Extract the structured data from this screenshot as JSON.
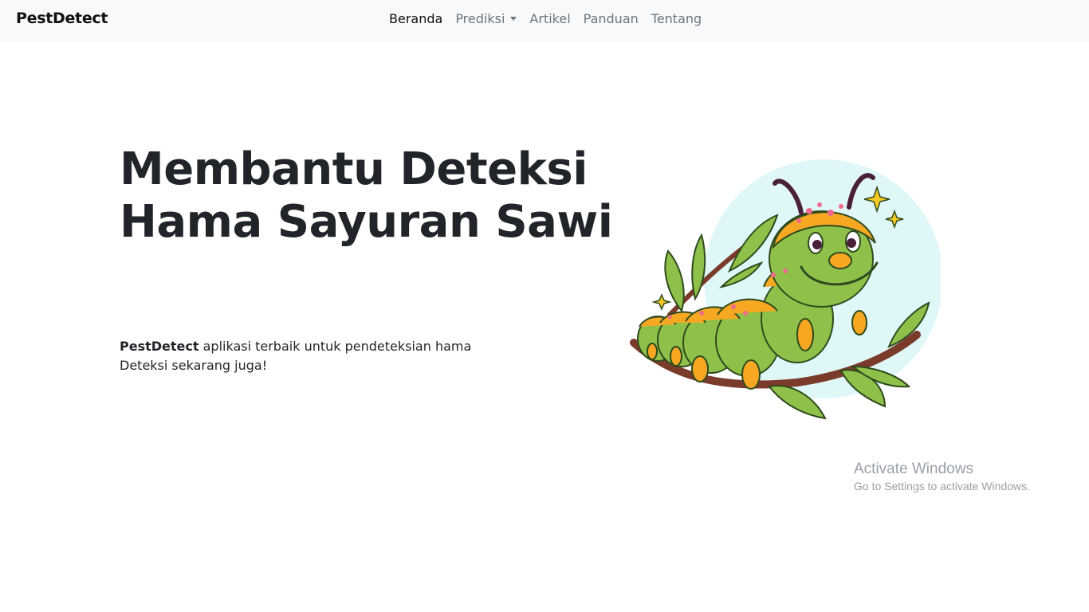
{
  "navbar": {
    "brand": "PestDetect",
    "items": [
      {
        "label": "Beranda",
        "active": true
      },
      {
        "label": "Prediksi",
        "dropdown": true
      },
      {
        "label": "Artikel"
      },
      {
        "label": "Panduan"
      },
      {
        "label": "Tentang"
      }
    ]
  },
  "hero": {
    "title_line1": "Membantu Deteksi",
    "title_line2": "Hama Sayuran Sawi",
    "desc_brand": "PestDetect",
    "desc_rest": " aplikasi terbaik untuk pendeteksian hama",
    "desc_line2": "Deteksi sekarang juga!",
    "illustration_icon": "caterpillar-illustration"
  },
  "watermark": {
    "title": "Activate Windows",
    "subtitle": "Go to Settings to activate Windows."
  },
  "colors": {
    "navbar_bg": "#f8f9fa",
    "text_dark": "#212529",
    "nav_muted": "#6c757d",
    "caterpillar_green": "#8fc14a",
    "caterpillar_orange": "#f7a823",
    "bg_circle": "#dff7f7"
  }
}
